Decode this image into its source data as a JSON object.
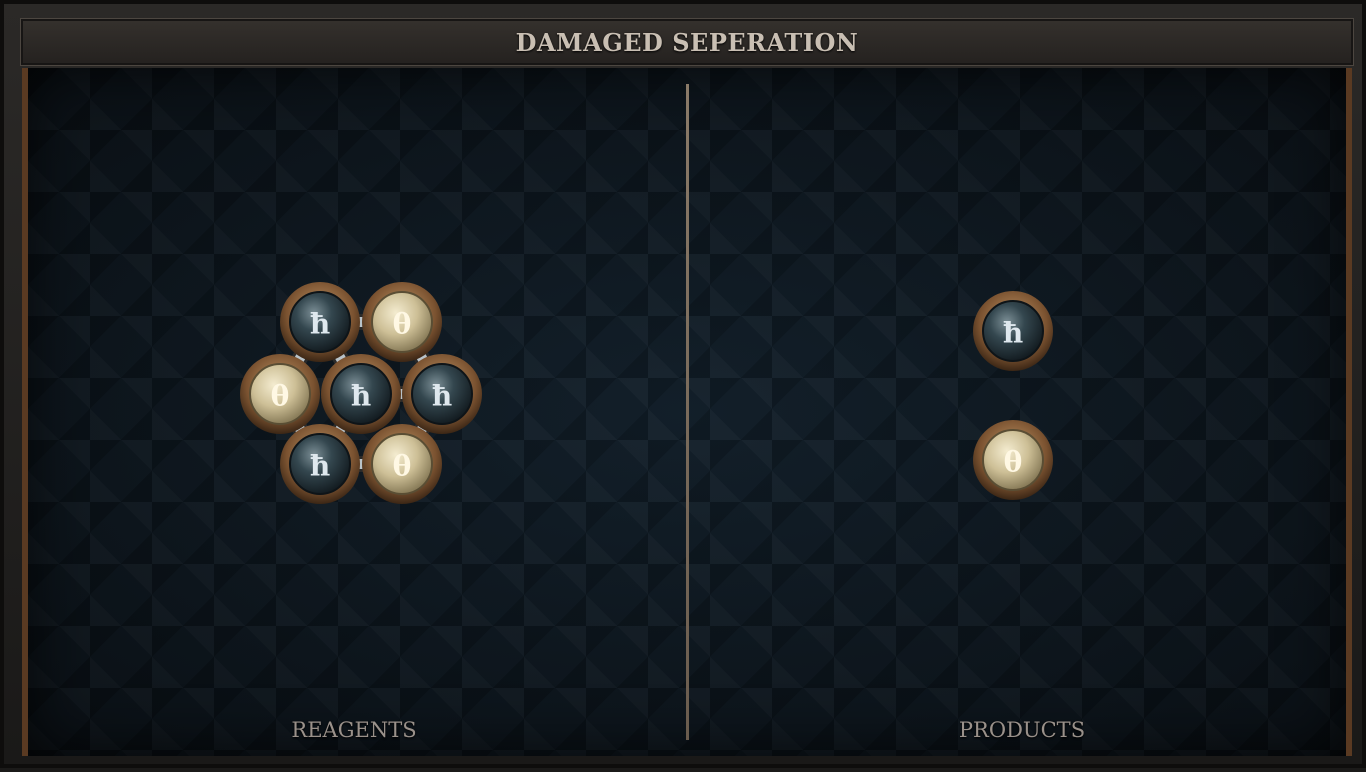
{
  "title": "DAMAGED SEPERATION",
  "panels": {
    "left_label": "REAGENTS",
    "right_label": "PRODUCTS"
  },
  "atom_types": {
    "salt": {
      "symbol": "ħ",
      "fill": "#2c3c44"
    },
    "earth": {
      "symbol": "θ",
      "fill": "#cfc4a0"
    }
  },
  "reagents": [
    {
      "type": "salt",
      "symbol": "ħ"
    },
    {
      "type": "earth",
      "symbol": "θ"
    },
    {
      "type": "earth",
      "symbol": "θ"
    },
    {
      "type": "salt",
      "symbol": "ħ"
    },
    {
      "type": "salt",
      "symbol": "ħ"
    },
    {
      "type": "salt",
      "symbol": "ħ"
    },
    {
      "type": "earth",
      "symbol": "θ"
    }
  ],
  "products": [
    {
      "type": "salt",
      "symbol": "ħ"
    },
    {
      "type": "earth",
      "symbol": "θ"
    }
  ],
  "colors": {
    "frame_bronze": "#8a5a32",
    "board_bg": "#121c25",
    "bond_steel": "#c7ced3"
  }
}
